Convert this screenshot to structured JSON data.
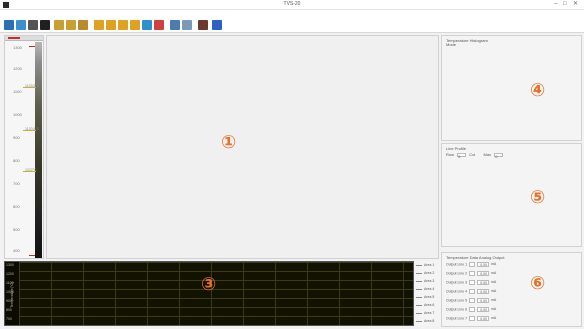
{
  "window": {
    "title": "TVS-20",
    "minimize_glyph": "–",
    "maximize_glyph": "□",
    "close_glyph": "✕"
  },
  "menu": [
    "Scene(O)",
    "Display(P)",
    "Palette",
    "Adjust Color",
    "Analysis",
    "Filter(T)",
    "Tools(C)",
    "Report(E)",
    "Config(C)",
    "Check Frame",
    "Help(H)"
  ],
  "toolbar_icons": [
    {
      "name": "open-icon",
      "color": "#2a6fb0"
    },
    {
      "name": "camera-icon",
      "color": "#3a8fd0"
    },
    {
      "name": "freeze-icon",
      "color": "#555555"
    },
    {
      "name": "palette-icon",
      "color": "#202020"
    },
    {
      "name": "measure-icon",
      "color": "#c8a030"
    },
    {
      "name": "measure-area-icon",
      "color": "#c8a030"
    },
    {
      "name": "export-icon",
      "color": "#b88a2a"
    },
    {
      "name": "folder-icon",
      "color": "#e0a020"
    },
    {
      "name": "folder-open-icon",
      "color": "#e0a020"
    },
    {
      "name": "save-icon",
      "color": "#e0a020"
    },
    {
      "name": "save-as-icon",
      "color": "#e0a020"
    },
    {
      "name": "image-icon",
      "color": "#2f8fcf"
    },
    {
      "name": "video-icon",
      "color": "#d04040"
    },
    {
      "name": "print-icon",
      "color": "#4b7bb0"
    },
    {
      "name": "copy-icon",
      "color": "#7a9ab8"
    },
    {
      "name": "book-icon",
      "color": "#6a3a2a"
    },
    {
      "name": "help-icon",
      "color": "#3060c0"
    }
  ],
  "scale": {
    "ticks": [
      "1300",
      "1200",
      "1100",
      "1000",
      "900",
      "800",
      "700",
      "600",
      "500",
      "400"
    ],
    "marks": [
      "1133.5°C",
      "1120.5°C",
      "1022°C"
    ]
  },
  "labels": {
    "image": "①",
    "histogram": "④",
    "line_profile": "⑤",
    "trend": "③",
    "output": "⑥"
  },
  "histogram_panel": {
    "title": "Temperature Histogram",
    "sub": "Mode"
  },
  "line_profile_panel": {
    "title": "Line Profile",
    "row_label": "Row",
    "col_label": "Col",
    "max_label": "Max",
    "row_value": "0",
    "max_value": "0"
  },
  "trend": {
    "y_title": "Temperature(°C)",
    "y_ticks": [
      "1300",
      "1200",
      "1100",
      "1000",
      "900",
      "800",
      "700"
    ]
  },
  "legend": [
    "Area 1",
    "Area 2",
    "Area 3",
    "Area 4",
    "Area 5",
    "Area 6",
    "Area 7",
    "Area 8"
  ],
  "output_panel": {
    "title": "Temperature Data Analog Output",
    "rows": [
      {
        "label": "Output Line 1",
        "value": "0.00",
        "unit": "mA"
      },
      {
        "label": "Output Line 2",
        "value": "0.00",
        "unit": "mA"
      },
      {
        "label": "Output Line 3",
        "value": "0.00",
        "unit": "mA"
      },
      {
        "label": "Output Line 4",
        "value": "0.00",
        "unit": "mA"
      },
      {
        "label": "Output Line 5",
        "value": "0.00",
        "unit": "mA"
      },
      {
        "label": "Output Line 6",
        "value": "0.00",
        "unit": "mA"
      },
      {
        "label": "Output Line 7",
        "value": "0.00",
        "unit": "mA"
      }
    ]
  }
}
